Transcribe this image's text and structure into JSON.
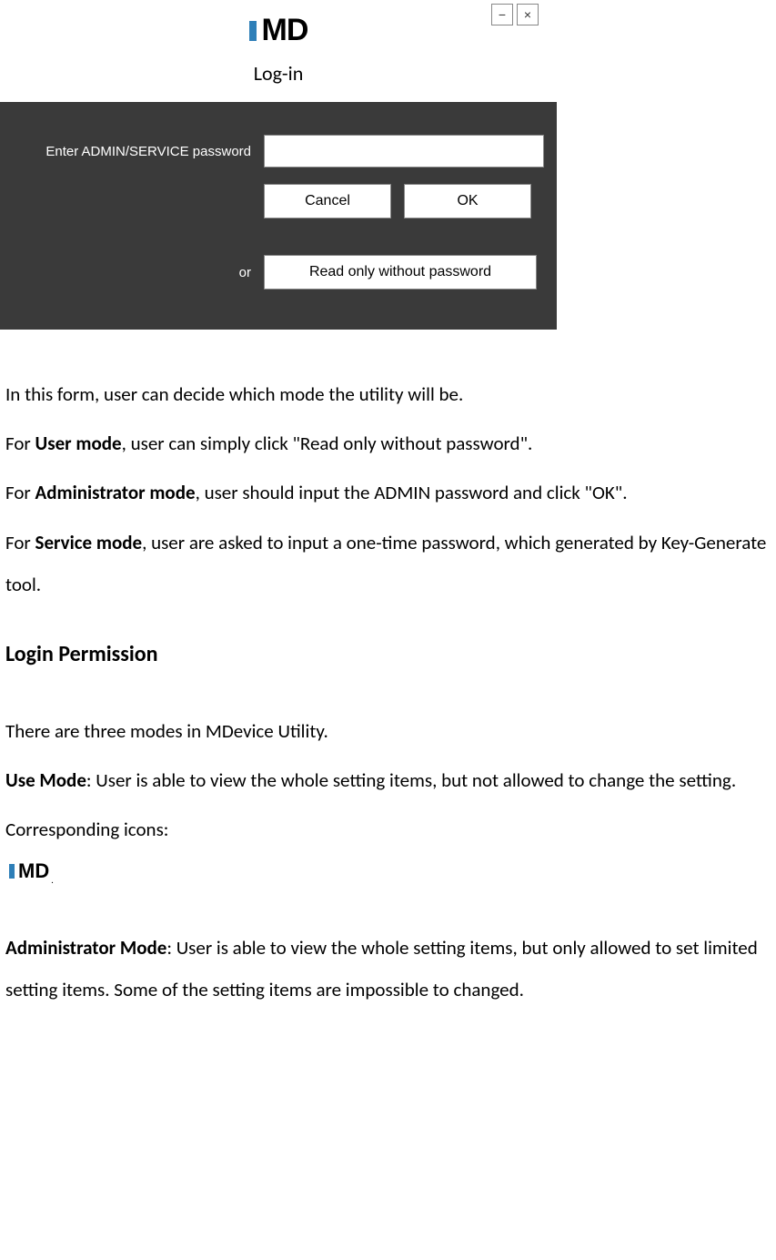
{
  "dialog": {
    "logo_text": "MD",
    "title": "Log-in",
    "password_label": "Enter ADMIN/SERVICE password",
    "password_value": "",
    "cancel_label": "Cancel",
    "ok_label": "OK",
    "or_label": "or",
    "readonly_label": "Read only without password",
    "minimize_glyph": "−",
    "close_glyph": "×"
  },
  "doc": {
    "p1": "In this form, user can decide which mode the utility will be.",
    "p2_prefix": "For ",
    "p2_bold": "User mode",
    "p2_rest": ", user can simply click \"Read only without password\".",
    "p3_prefix": "For ",
    "p3_bold": "Administrator mode",
    "p3_rest": ", user should input the ADMIN password and click \"OK\".",
    "p4_prefix": "For ",
    "p4_bold": "Service mode",
    "p4_rest": ", user are asked to input a one-time password, which generated by Key-Generate tool.",
    "section_heading": "Login Permission",
    "p5": "There are three modes in MDevice Utility.",
    "p6_bold": "Use Mode",
    "p6_rest": ": User is able to view the whole setting items, but not allowed to change the setting.",
    "p7": "Corresponding icons:",
    "small_logo_text": "MD",
    "p8_bold": "Administrator Mode",
    "p8_rest": ": User is able to view the whole setting items, but only allowed to set limited setting items. Some of the setting items are impossible to changed."
  }
}
